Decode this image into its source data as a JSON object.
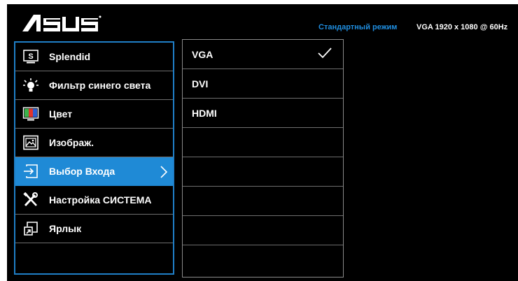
{
  "header": {
    "brand": "ASUS",
    "mode_label": "Стандартный режим",
    "signal_info": "VGA 1920 x 1080 @ 60Hz"
  },
  "main_menu": {
    "items": [
      {
        "label": "Splendid",
        "icon": "splendid-icon"
      },
      {
        "label": "Фильтр синего света",
        "icon": "blue-light-filter-icon"
      },
      {
        "label": "Цвет",
        "icon": "color-icon"
      },
      {
        "label": "Изображ.",
        "icon": "image-icon"
      },
      {
        "label": "Выбор Входа",
        "icon": "input-select-icon",
        "selected": true
      },
      {
        "label": "Настройка СИСТЕМА",
        "icon": "system-setup-icon"
      },
      {
        "label": "Ярлык",
        "icon": "shortcut-icon"
      }
    ]
  },
  "sub_menu": {
    "items": [
      {
        "label": "VGA",
        "checked": true
      },
      {
        "label": "DVI"
      },
      {
        "label": "HDMI"
      }
    ]
  },
  "colors": {
    "accent": "#1f8ad6",
    "border": "#1f7fc7",
    "background": "#000000"
  }
}
